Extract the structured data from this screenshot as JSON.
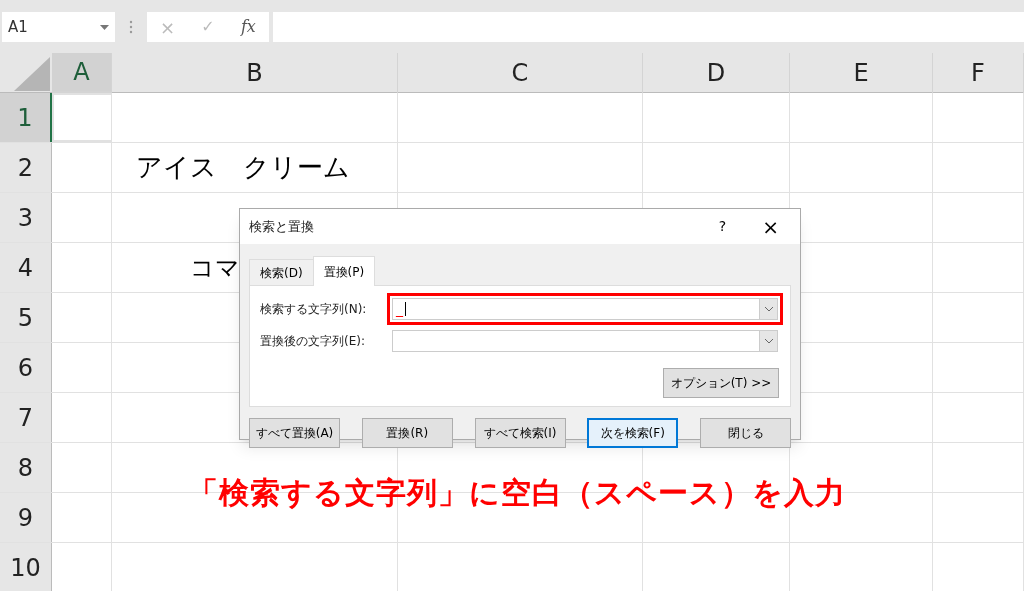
{
  "formula_bar": {
    "name_box": "A1",
    "cancel": "×",
    "enter": "✓",
    "function": "fx"
  },
  "columns": [
    {
      "label": "A",
      "selected": true
    },
    {
      "label": "B",
      "selected": false
    },
    {
      "label": "C",
      "selected": false
    },
    {
      "label": "D",
      "selected": false
    },
    {
      "label": "E",
      "selected": false
    },
    {
      "label": "F",
      "selected": false
    }
  ],
  "rows": [
    {
      "label": "1",
      "selected": true
    },
    {
      "label": "2",
      "selected": false,
      "cells": {
        "B": "アイス　クリーム"
      }
    },
    {
      "label": "3",
      "selected": false
    },
    {
      "label": "4",
      "selected": false,
      "cells": {
        "B": "コマ"
      }
    },
    {
      "label": "5",
      "selected": false
    },
    {
      "label": "6",
      "selected": false
    },
    {
      "label": "7",
      "selected": false
    },
    {
      "label": "8",
      "selected": false
    },
    {
      "label": "9",
      "selected": false
    },
    {
      "label": "10",
      "selected": false
    }
  ],
  "dialog": {
    "title": "検索と置換",
    "help": "?",
    "close": "×",
    "tabs": [
      {
        "label": "検索(D)",
        "selected": false
      },
      {
        "label": "置換(P)",
        "selected": true
      }
    ],
    "fields": [
      {
        "label": "検索する文字列(N):",
        "value": "_",
        "highlighted": true
      },
      {
        "label": "置換後の文字列(E):",
        "highlighted": false
      }
    ],
    "options_button": {
      "label": "オプション(T) >>"
    },
    "buttons": [
      {
        "label": "すべて置換(A)",
        "default": false
      },
      {
        "label": "置換(R)",
        "default": false
      },
      {
        "label": "すべて検索(I)",
        "default": false
      },
      {
        "label": "次を検索(F)",
        "default": true
      },
      {
        "label": "閉じる",
        "default": false
      }
    ]
  },
  "annotation": "「検索する文字列」に空白（スペース）を入力"
}
